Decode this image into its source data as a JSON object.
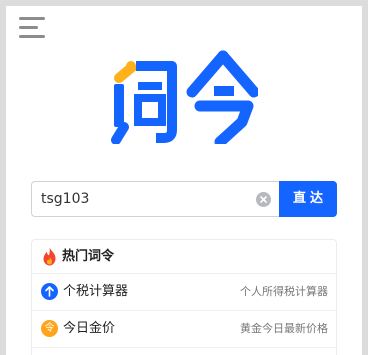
{
  "logo": {
    "text": "词令",
    "primary_color": "#1465ff",
    "accent_color": "#ffb11b"
  },
  "search": {
    "value": "tsg103",
    "placeholder": "",
    "button_label": "直达"
  },
  "hot": {
    "title": "热门词令",
    "items": [
      {
        "name": "个税计算器",
        "desc": "个人所得税计算器",
        "icon": "arrow-up-icon",
        "icon_color": "#1465ff"
      },
      {
        "name": "今日金价",
        "desc": "黄金今日最新价格",
        "icon": "ling-badge-icon",
        "icon_color": "#ffa41b"
      }
    ]
  }
}
